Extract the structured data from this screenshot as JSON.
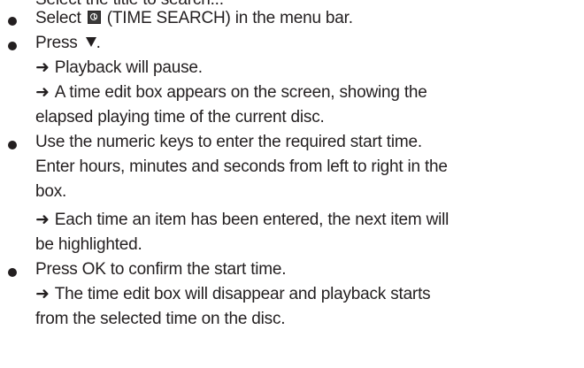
{
  "top_cut_text": "Select the title to search...",
  "steps": [
    {
      "lines": [
        {
          "before": "Select ",
          "icon": "clock-icon",
          "after": " (TIME SEARCH) in the menu bar."
        }
      ]
    },
    {
      "lines": [
        {
          "text": "Press ",
          "icon": "down-triangle-icon",
          "after": "."
        },
        {
          "arrow": "➜",
          "text": "Playback will pause."
        },
        {
          "arrow": "➜",
          "text": "A time edit box appears on the screen, showing the"
        },
        {
          "text": "elapsed playing time of the current disc."
        }
      ]
    },
    {
      "lines": [
        {
          "text": "Use the numeric keys to enter the required start time."
        },
        {
          "text": "Enter hours, minutes and seconds from left to right in the"
        },
        {
          "text": "box."
        },
        {
          "arrow": "➜",
          "text": "Each time an item has been entered, the next item will"
        },
        {
          "text": "be highlighted."
        }
      ]
    },
    {
      "lines": [
        {
          "text": "Press OK to confirm the start time."
        },
        {
          "arrow": "➜",
          "text": "The time edit box will disappear and playback starts"
        },
        {
          "text": "from the selected time on the disc."
        }
      ]
    }
  ]
}
